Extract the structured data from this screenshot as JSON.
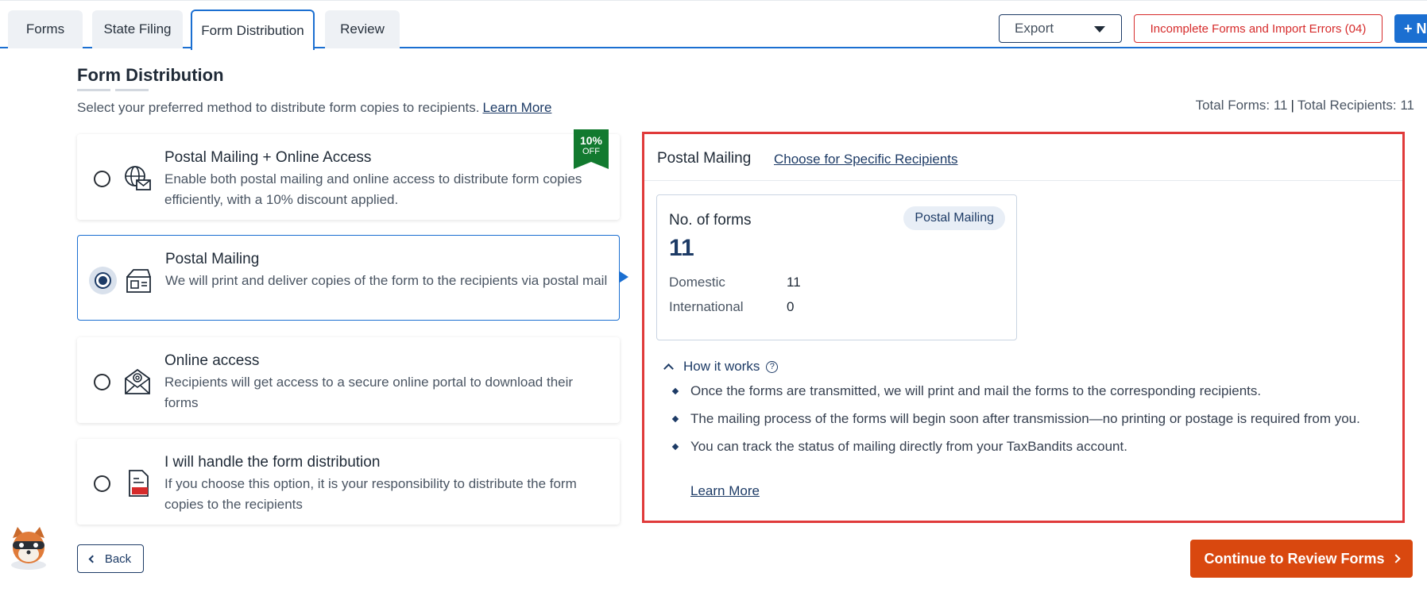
{
  "tabs": [
    {
      "label": "Forms",
      "active": false
    },
    {
      "label": "State Filing",
      "active": false
    },
    {
      "label": "Form Distribution",
      "active": true
    },
    {
      "label": "Review",
      "active": false
    }
  ],
  "toolbar": {
    "export_label": "Export",
    "errors_label": "Incomplete Forms and Import Errors (04)",
    "new_label": "+ N"
  },
  "header": {
    "title": "Form Distribution",
    "subtitle": "Select your preferred method to distribute form copies to recipients.",
    "learn_more": "Learn More",
    "total_forms": "Total Forms: 11",
    "total_recipients": "Total Recipients: 11",
    "separator": "|"
  },
  "options": [
    {
      "title": "Postal Mailing + Online Access",
      "description": "Enable both postal mailing and online access to distribute form copies efficiently, with a 10% discount applied.",
      "selected": false,
      "icon": "globe-mail-icon",
      "badge": {
        "percent": "10%",
        "text": "OFF"
      }
    },
    {
      "title": "Postal Mailing",
      "description": "We will print and deliver copies of the form to the recipients via postal mail",
      "selected": true,
      "icon": "mail-envelope-icon"
    },
    {
      "title": "Online access",
      "description": "Recipients will get access to a secure online portal to download their forms",
      "selected": false,
      "icon": "email-at-icon"
    },
    {
      "title": "I will handle the form distribution",
      "description": "If you choose this option, it is your responsibility to distribute the form copies to the recipients",
      "selected": false,
      "icon": "pdf-file-icon"
    }
  ],
  "panel": {
    "title": "Postal Mailing",
    "link": "Choose for Specific Recipients",
    "forms_label": "No. of forms",
    "forms_count": "11",
    "pill": "Postal Mailing",
    "domestic_label": "Domestic",
    "domestic_value": "11",
    "international_label": "International",
    "international_value": "0",
    "how_label": "How it works",
    "how_help": "?",
    "bullets": [
      "Once the forms are transmitted, we will print and mail the forms to the corresponding recipients.",
      "The mailing process of the forms will begin soon after transmission—no printing or postage is required from you.",
      "You can track the status of mailing directly from your TaxBandits account."
    ],
    "learn_more": "Learn More"
  },
  "footer": {
    "back_label": "Back",
    "continue_label": "Continue to Review Forms"
  },
  "colors": {
    "accent": "#1b6fd1",
    "navy": "#1d3b66",
    "continue": "#d9480f",
    "error": "#d62b2b",
    "badge": "#127a2f",
    "highlight_border": "#e03a3a"
  }
}
